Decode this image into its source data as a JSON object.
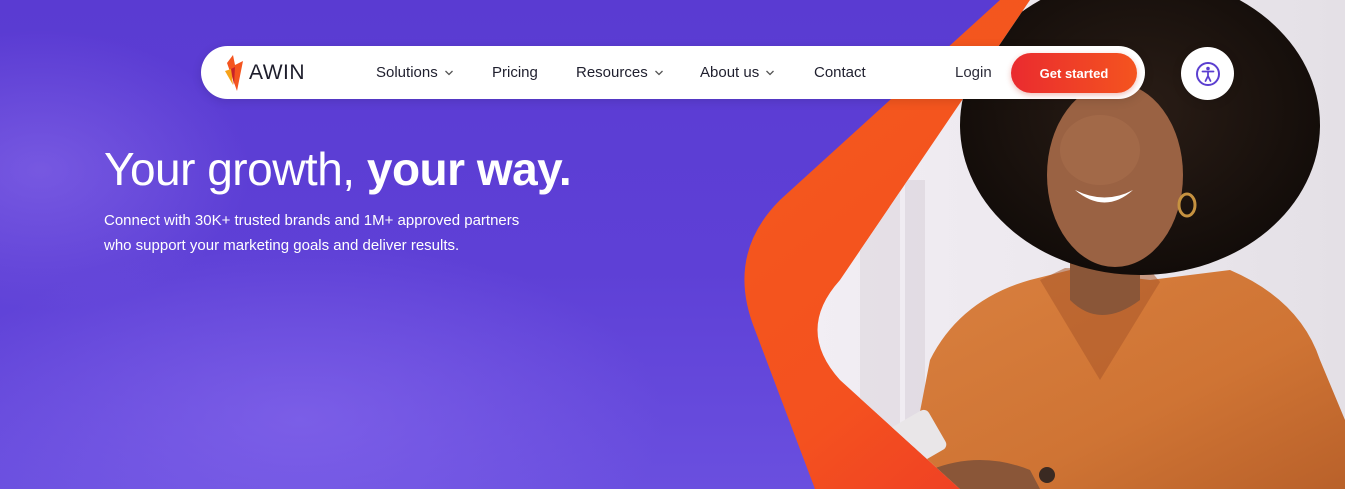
{
  "brand": {
    "name": "AWIN",
    "colors": {
      "primary_purple": "#5b3fd0",
      "accent_orange": "#f4541f",
      "accent_red": "#ea2b2f"
    }
  },
  "nav": {
    "items": [
      {
        "label": "Solutions",
        "has_dropdown": true,
        "icon": "chevron-down-icon"
      },
      {
        "label": "Pricing",
        "has_dropdown": false
      },
      {
        "label": "Resources",
        "has_dropdown": true,
        "icon": "chevron-down-icon"
      },
      {
        "label": "About us",
        "has_dropdown": true,
        "icon": "chevron-down-icon"
      },
      {
        "label": "Contact",
        "has_dropdown": false
      }
    ],
    "login_label": "Login",
    "cta_label": "Get started"
  },
  "accessibility": {
    "icon": "accessibility-icon"
  },
  "hero": {
    "headline_regular": "Your growth, ",
    "headline_bold": "your way.",
    "subtext_line1": "Connect with 30K+ trusted brands and 1M+ approved partners",
    "subtext_line2": "who support your marketing goals and deliver results."
  }
}
